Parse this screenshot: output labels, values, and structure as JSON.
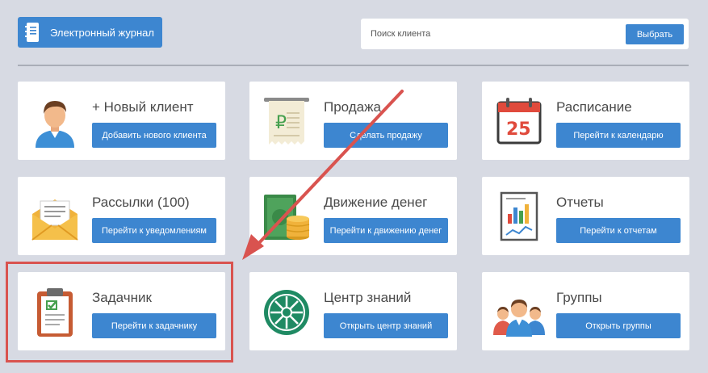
{
  "header": {
    "journal_label": "Электронный журнал",
    "search_placeholder": "Поиск клиента",
    "search_button": "Выбрать"
  },
  "cards": [
    {
      "title": "+ Новый клиент",
      "button": "Добавить нового клиента",
      "icon": "person-icon"
    },
    {
      "title": "Продажа",
      "button": "Сделать продажу",
      "icon": "receipt-icon"
    },
    {
      "title": "Расписание",
      "button": "Перейти к календарю",
      "icon": "calendar-icon",
      "calendar_day": "25"
    },
    {
      "title": "Рассылки (100)",
      "button": "Перейти к уведомлениям",
      "icon": "envelope-icon"
    },
    {
      "title": "Движение денег",
      "button": "Перейти к движению денег",
      "icon": "money-icon"
    },
    {
      "title": "Отчеты",
      "button": "Перейти к отчетам",
      "icon": "report-icon"
    },
    {
      "title": "Задачник",
      "button": "Перейти к задачнику",
      "icon": "clipboard-icon"
    },
    {
      "title": "Центр знаний",
      "button": "Открыть центр знаний",
      "icon": "knowledge-icon"
    },
    {
      "title": "Группы",
      "button": "Открыть группы",
      "icon": "group-icon"
    }
  ],
  "colors": {
    "accent": "#3d86d0",
    "background": "#d7dae3",
    "highlight": "#d9534f"
  }
}
